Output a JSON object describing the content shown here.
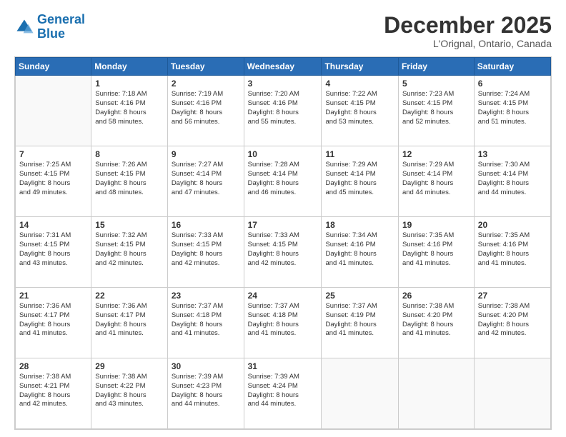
{
  "logo": {
    "line1": "General",
    "line2": "Blue"
  },
  "title": "December 2025",
  "subtitle": "L'Orignal, Ontario, Canada",
  "days_header": [
    "Sunday",
    "Monday",
    "Tuesday",
    "Wednesday",
    "Thursday",
    "Friday",
    "Saturday"
  ],
  "weeks": [
    [
      {
        "day": "",
        "info": ""
      },
      {
        "day": "1",
        "info": "Sunrise: 7:18 AM\nSunset: 4:16 PM\nDaylight: 8 hours\nand 58 minutes."
      },
      {
        "day": "2",
        "info": "Sunrise: 7:19 AM\nSunset: 4:16 PM\nDaylight: 8 hours\nand 56 minutes."
      },
      {
        "day": "3",
        "info": "Sunrise: 7:20 AM\nSunset: 4:16 PM\nDaylight: 8 hours\nand 55 minutes."
      },
      {
        "day": "4",
        "info": "Sunrise: 7:22 AM\nSunset: 4:15 PM\nDaylight: 8 hours\nand 53 minutes."
      },
      {
        "day": "5",
        "info": "Sunrise: 7:23 AM\nSunset: 4:15 PM\nDaylight: 8 hours\nand 52 minutes."
      },
      {
        "day": "6",
        "info": "Sunrise: 7:24 AM\nSunset: 4:15 PM\nDaylight: 8 hours\nand 51 minutes."
      }
    ],
    [
      {
        "day": "7",
        "info": "Sunrise: 7:25 AM\nSunset: 4:15 PM\nDaylight: 8 hours\nand 49 minutes."
      },
      {
        "day": "8",
        "info": "Sunrise: 7:26 AM\nSunset: 4:15 PM\nDaylight: 8 hours\nand 48 minutes."
      },
      {
        "day": "9",
        "info": "Sunrise: 7:27 AM\nSunset: 4:14 PM\nDaylight: 8 hours\nand 47 minutes."
      },
      {
        "day": "10",
        "info": "Sunrise: 7:28 AM\nSunset: 4:14 PM\nDaylight: 8 hours\nand 46 minutes."
      },
      {
        "day": "11",
        "info": "Sunrise: 7:29 AM\nSunset: 4:14 PM\nDaylight: 8 hours\nand 45 minutes."
      },
      {
        "day": "12",
        "info": "Sunrise: 7:29 AM\nSunset: 4:14 PM\nDaylight: 8 hours\nand 44 minutes."
      },
      {
        "day": "13",
        "info": "Sunrise: 7:30 AM\nSunset: 4:14 PM\nDaylight: 8 hours\nand 44 minutes."
      }
    ],
    [
      {
        "day": "14",
        "info": "Sunrise: 7:31 AM\nSunset: 4:15 PM\nDaylight: 8 hours\nand 43 minutes."
      },
      {
        "day": "15",
        "info": "Sunrise: 7:32 AM\nSunset: 4:15 PM\nDaylight: 8 hours\nand 42 minutes."
      },
      {
        "day": "16",
        "info": "Sunrise: 7:33 AM\nSunset: 4:15 PM\nDaylight: 8 hours\nand 42 minutes."
      },
      {
        "day": "17",
        "info": "Sunrise: 7:33 AM\nSunset: 4:15 PM\nDaylight: 8 hours\nand 42 minutes."
      },
      {
        "day": "18",
        "info": "Sunrise: 7:34 AM\nSunset: 4:16 PM\nDaylight: 8 hours\nand 41 minutes."
      },
      {
        "day": "19",
        "info": "Sunrise: 7:35 AM\nSunset: 4:16 PM\nDaylight: 8 hours\nand 41 minutes."
      },
      {
        "day": "20",
        "info": "Sunrise: 7:35 AM\nSunset: 4:16 PM\nDaylight: 8 hours\nand 41 minutes."
      }
    ],
    [
      {
        "day": "21",
        "info": "Sunrise: 7:36 AM\nSunset: 4:17 PM\nDaylight: 8 hours\nand 41 minutes."
      },
      {
        "day": "22",
        "info": "Sunrise: 7:36 AM\nSunset: 4:17 PM\nDaylight: 8 hours\nand 41 minutes."
      },
      {
        "day": "23",
        "info": "Sunrise: 7:37 AM\nSunset: 4:18 PM\nDaylight: 8 hours\nand 41 minutes."
      },
      {
        "day": "24",
        "info": "Sunrise: 7:37 AM\nSunset: 4:18 PM\nDaylight: 8 hours\nand 41 minutes."
      },
      {
        "day": "25",
        "info": "Sunrise: 7:37 AM\nSunset: 4:19 PM\nDaylight: 8 hours\nand 41 minutes."
      },
      {
        "day": "26",
        "info": "Sunrise: 7:38 AM\nSunset: 4:20 PM\nDaylight: 8 hours\nand 41 minutes."
      },
      {
        "day": "27",
        "info": "Sunrise: 7:38 AM\nSunset: 4:20 PM\nDaylight: 8 hours\nand 42 minutes."
      }
    ],
    [
      {
        "day": "28",
        "info": "Sunrise: 7:38 AM\nSunset: 4:21 PM\nDaylight: 8 hours\nand 42 minutes."
      },
      {
        "day": "29",
        "info": "Sunrise: 7:38 AM\nSunset: 4:22 PM\nDaylight: 8 hours\nand 43 minutes."
      },
      {
        "day": "30",
        "info": "Sunrise: 7:39 AM\nSunset: 4:23 PM\nDaylight: 8 hours\nand 44 minutes."
      },
      {
        "day": "31",
        "info": "Sunrise: 7:39 AM\nSunset: 4:24 PM\nDaylight: 8 hours\nand 44 minutes."
      },
      {
        "day": "",
        "info": ""
      },
      {
        "day": "",
        "info": ""
      },
      {
        "day": "",
        "info": ""
      }
    ]
  ]
}
